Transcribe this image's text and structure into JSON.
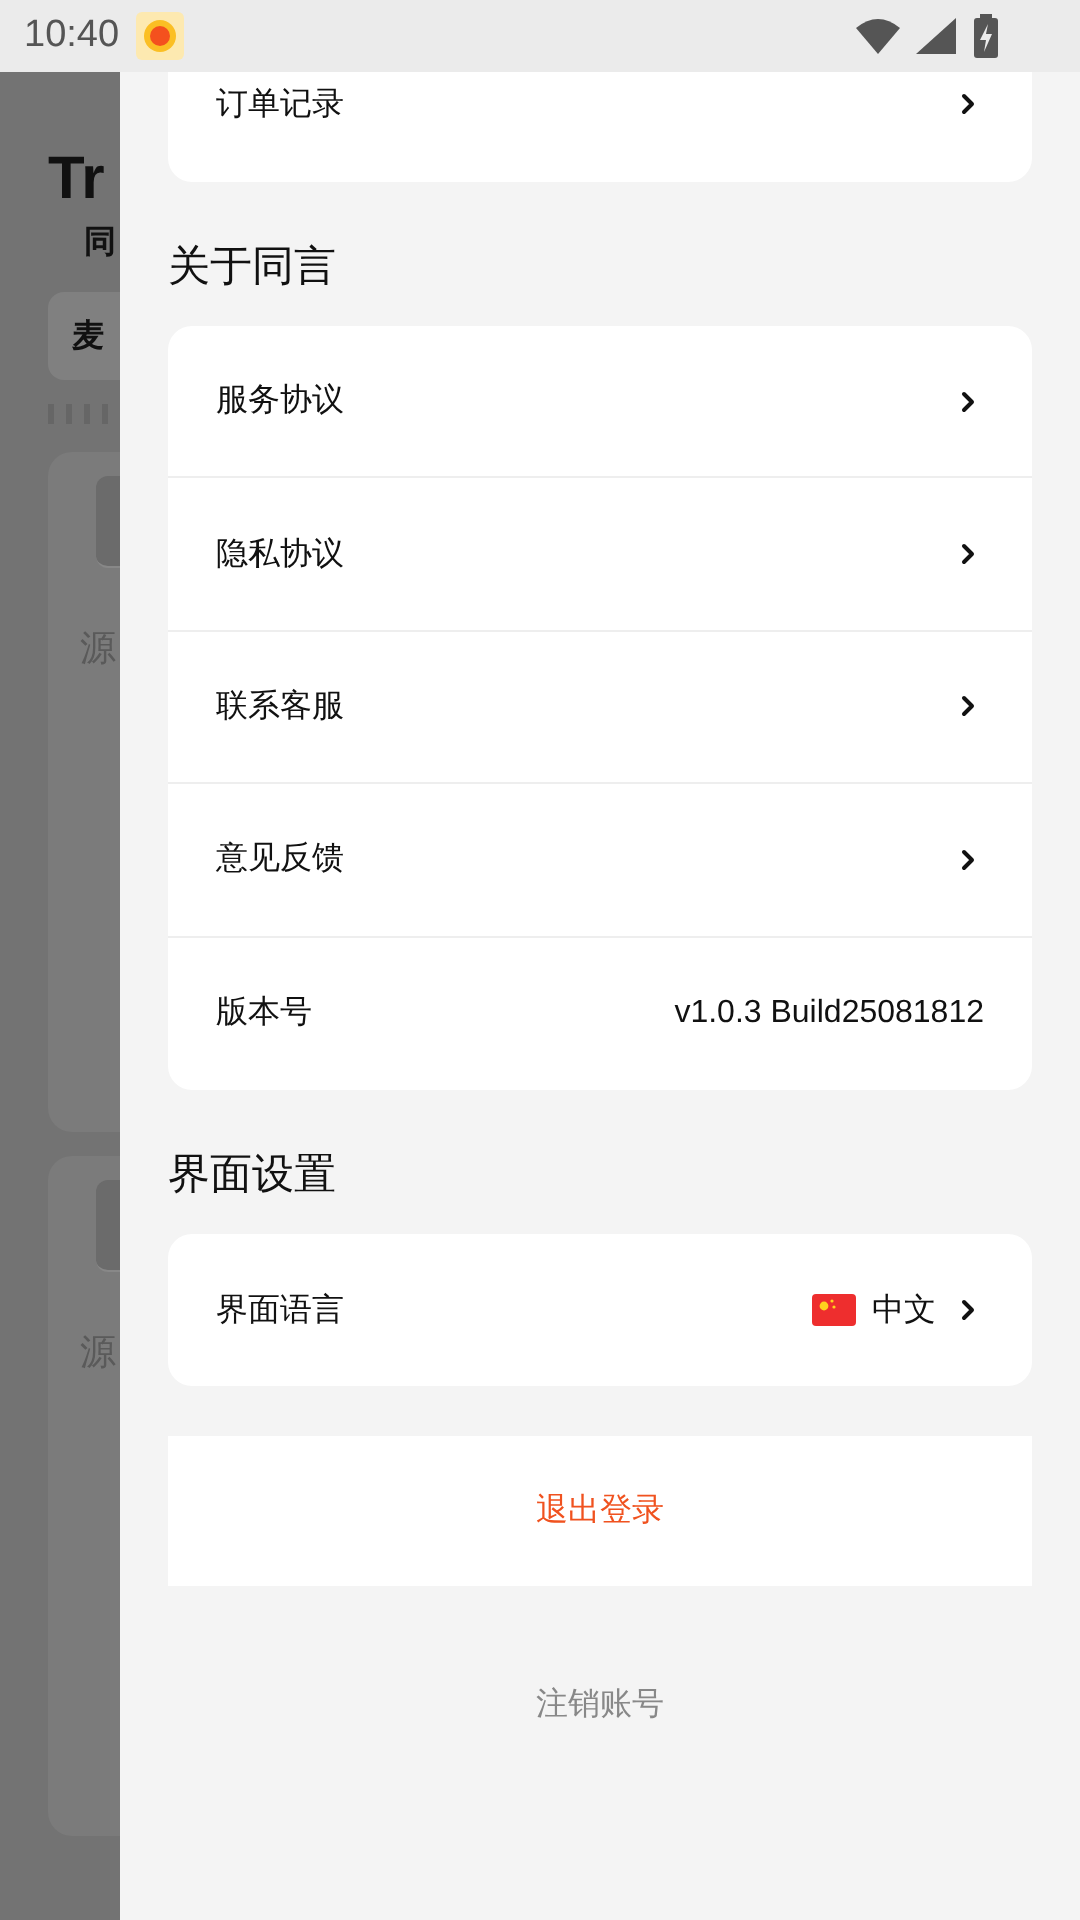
{
  "status_bar": {
    "time": "10:40"
  },
  "background_app": {
    "title": "Tr",
    "subtitle": "同",
    "tab": "麦",
    "cards": [
      {
        "label": "源"
      },
      {
        "label": "源"
      }
    ]
  },
  "drawer": {
    "top_card": {
      "items": [
        {
          "label": "订单记录",
          "kind": "link"
        }
      ]
    },
    "sections": [
      {
        "title": "关于同言",
        "items": [
          {
            "label": "服务协议",
            "kind": "link"
          },
          {
            "label": "隐私协议",
            "kind": "link"
          },
          {
            "label": "联系客服",
            "kind": "link"
          },
          {
            "label": "意见反馈",
            "kind": "link"
          },
          {
            "label": "版本号",
            "kind": "value",
            "value": "v1.0.3 Build25081812"
          }
        ]
      },
      {
        "title": "界面设置",
        "items": [
          {
            "label": "界面语言",
            "kind": "language",
            "value": "中文"
          }
        ]
      }
    ],
    "logout_button": "退出登录",
    "delete_account": "注销账号"
  }
}
